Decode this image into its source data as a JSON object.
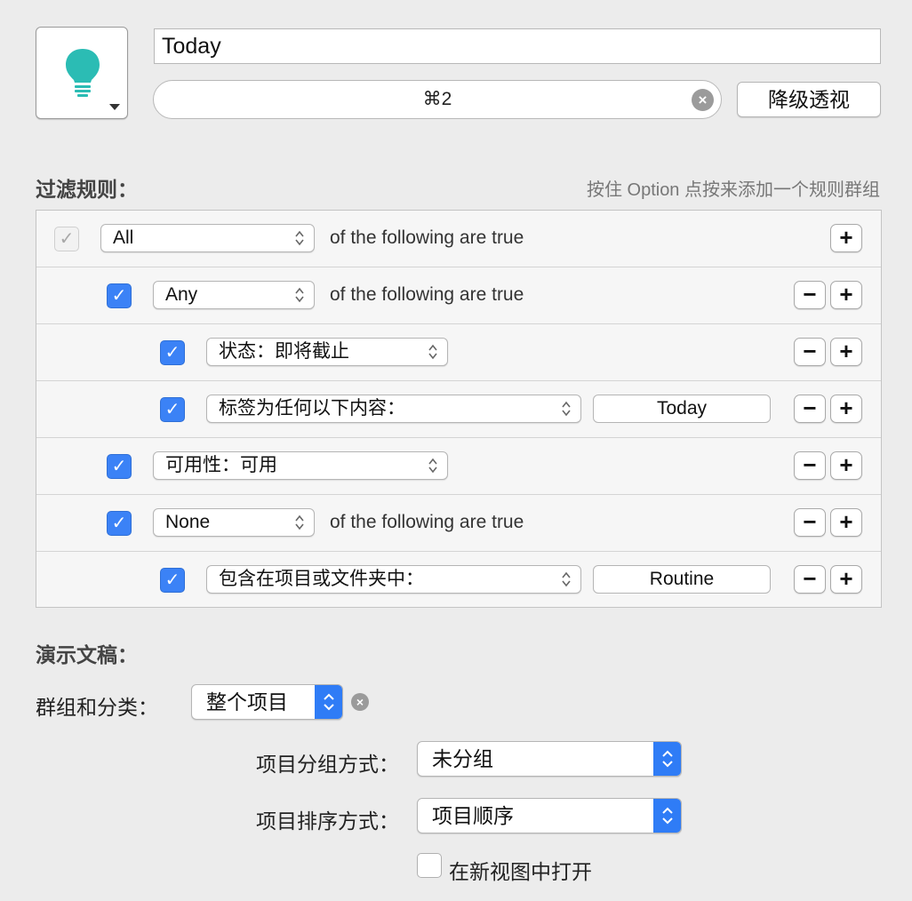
{
  "header": {
    "title_value": "Today",
    "shortcut_value": "⌘2",
    "demote_label": "降级透视",
    "icon_color": "#2bbcb4"
  },
  "rules": {
    "section_title": "过滤规则：",
    "hint": "按住 Option 点按来添加一个规则群组",
    "rows": [
      {
        "checked": true,
        "enabled": false,
        "popup": "All",
        "suffix": "of the following are true",
        "buttons": [
          "+"
        ]
      },
      {
        "checked": true,
        "enabled": true,
        "popup": "Any",
        "suffix": "of the following are true",
        "buttons": [
          "−",
          "+"
        ]
      },
      {
        "checked": true,
        "enabled": true,
        "popup": "状态：即将截止",
        "buttons": [
          "−",
          "+"
        ]
      },
      {
        "checked": true,
        "enabled": true,
        "popup": "标签为任何以下内容：",
        "value": "Today",
        "buttons": [
          "−",
          "+"
        ]
      },
      {
        "checked": true,
        "enabled": true,
        "popup": "可用性：可用",
        "buttons": [
          "−",
          "+"
        ]
      },
      {
        "checked": true,
        "enabled": true,
        "popup": "None",
        "suffix": "of the following are true",
        "buttons": [
          "−",
          "+"
        ]
      },
      {
        "checked": true,
        "enabled": true,
        "popup": "包含在项目或文件夹中：",
        "value": "Routine",
        "buttons": [
          "−",
          "+"
        ]
      }
    ],
    "check_glyph": "✓",
    "plus_glyph": "+",
    "minus_glyph": "−"
  },
  "presentation": {
    "section_title": "演示文稿：",
    "group_sort_label": "群组和分类：",
    "group_sort_value": "整个项目",
    "project_group_label": "项目分组方式：",
    "project_group_value": "未分组",
    "project_sort_label": "项目排序方式：",
    "project_sort_value": "项目顺序",
    "open_new_window_label": "在新视图中打开",
    "open_new_window_checked": false,
    "clear_glyph": "×",
    "accent_color": "#2f7cf6"
  }
}
